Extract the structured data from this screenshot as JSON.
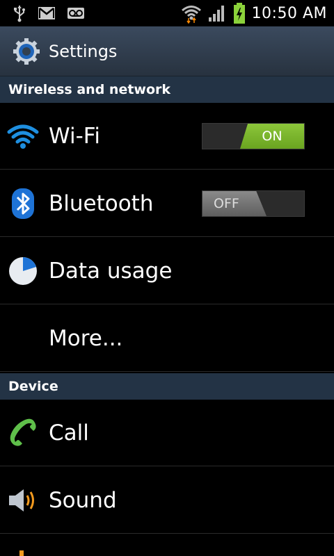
{
  "status_bar": {
    "time": "10:50 AM",
    "icons": [
      "usb-icon",
      "gmail-icon",
      "voicemail-icon",
      "wifi-signal-icon",
      "cell-signal-icon",
      "battery-charging-icon"
    ]
  },
  "action_bar": {
    "title": "Settings",
    "icon": "settings-gear-icon"
  },
  "sections": [
    {
      "header": "Wireless and network",
      "items": [
        {
          "label": "Wi-Fi",
          "icon": "wifi-icon",
          "toggle": "ON"
        },
        {
          "label": "Bluetooth",
          "icon": "bluetooth-icon",
          "toggle": "OFF"
        },
        {
          "label": "Data usage",
          "icon": "data-usage-icon"
        },
        {
          "label": "More...",
          "icon": null
        }
      ]
    },
    {
      "header": "Device",
      "items": [
        {
          "label": "Call",
          "icon": "phone-icon"
        },
        {
          "label": "Sound",
          "icon": "speaker-icon"
        }
      ]
    }
  ],
  "colors": {
    "section_header_bg": "#233345",
    "toggle_on": "#7ab530",
    "toggle_off": "#777777",
    "accent_blue": "#1e8fe0"
  }
}
